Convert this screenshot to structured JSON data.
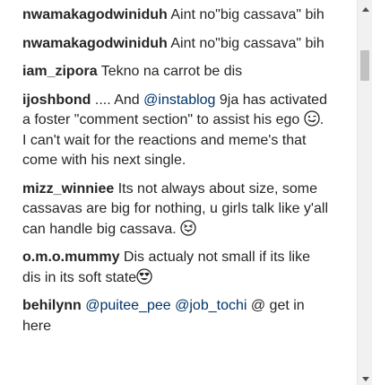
{
  "comments": [
    {
      "username": "nwamakagodwiniduh",
      "text": "Aint no\"big cassava\" bih"
    },
    {
      "username": "nwamakagodwiniduh",
      "text": "Aint no\"big cassava\" bih"
    },
    {
      "username": "iam_zipora",
      "text": "Tekno na carrot be dis"
    },
    {
      "username": "ijoshbond",
      "text_before": ".... And ",
      "mention": "@instablog",
      "text_mid": " 9ja has activated a foster \"comment section\" to assist his ego ",
      "emoji": "winking-tongue-face-emoji",
      "text_after": ". I can't wait for the reactions and meme's that come with his next single."
    },
    {
      "username": "mizz_winniee",
      "text": "Its not always about size, some cassavas are big for nothing, u girls talk like y'all can handle big cassava. ",
      "emoji": "squinting-tongue-face-emoji"
    },
    {
      "username": "o.m.o.mummy",
      "text": "Dis actualy not small if its like dis in its soft state",
      "emoji": "heart-eyes-face-emoji"
    },
    {
      "username": "behilynn",
      "mention1": "@puitee_pee",
      "mention2": "@job_tochi",
      "text_tail": " @ get in here"
    }
  ],
  "scrollbar": {
    "up_icon": "triangle-up-icon",
    "down_icon": "triangle-down-icon"
  }
}
